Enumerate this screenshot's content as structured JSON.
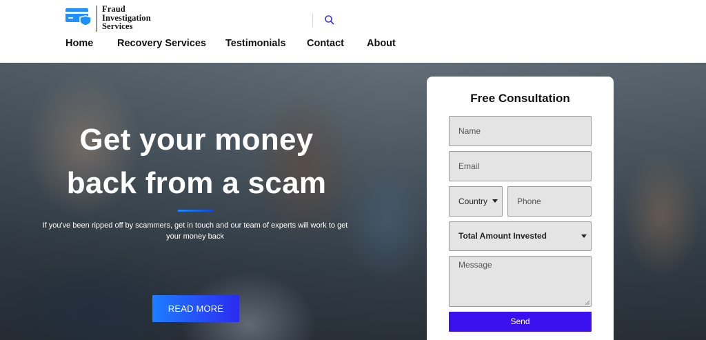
{
  "brand": {
    "line1": "Fraud",
    "line2": "Investigation",
    "line3": "Services",
    "icon": "credit-card-shield-icon",
    "color": "#1e90ff"
  },
  "header": {
    "search_icon": "search-icon",
    "nav": [
      "Home",
      "Recovery Services",
      "Testimonials",
      "Contact",
      "About"
    ]
  },
  "hero": {
    "title_line1": "Get your money",
    "title_line2": "back from a scam",
    "subtitle": "If you've been ripped off by scammers, get in touch and our team of experts will work to get your money back",
    "cta_label": "READ MORE"
  },
  "form": {
    "title": "Free Consultation",
    "name_placeholder": "Name",
    "email_placeholder": "Email",
    "country_value": "Country",
    "phone_placeholder": "Phone",
    "amount_value": "Total Amount Invested",
    "message_placeholder": "Message",
    "submit_label": "Send"
  },
  "colors": {
    "accent": "#3a10ee",
    "cta": "#1e7dff",
    "field_bg": "#e4e4e4"
  }
}
